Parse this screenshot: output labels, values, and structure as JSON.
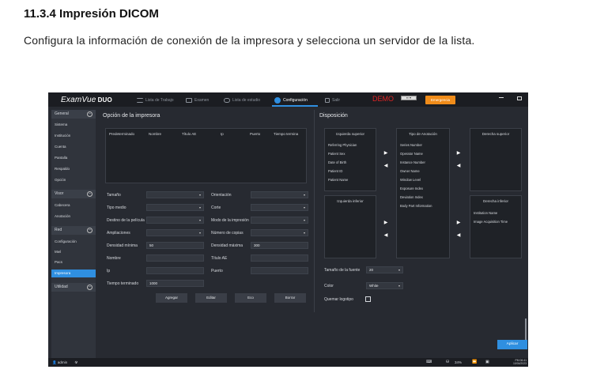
{
  "doc": {
    "heading": "11.3.4 Impresión DICOM",
    "paragraph": "Configura la información de conexión de la impresora y selecciona un servidor de la lista."
  },
  "app": {
    "logo": "ExamVue",
    "logo_suffix": "DUO",
    "nav_tabs": [
      {
        "label": "Lista de Trabajo"
      },
      {
        "label": "Examen"
      },
      {
        "label": "Lista de estudio"
      },
      {
        "label": "Configuración"
      },
      {
        "label": "Salir"
      }
    ],
    "demo_text": "DEMO",
    "emergency_label": "Emergencia",
    "accent_color": "#2f8fe0",
    "emergency_color": "#f08c1a"
  },
  "sidebar": {
    "groups": [
      {
        "label": "General",
        "items": [
          "Sistema",
          "Institución",
          "Cuenta",
          "Pantalla",
          "Respaldo",
          "Opción"
        ]
      },
      {
        "label": "Visor",
        "items": [
          "Cabecera",
          "Anotación"
        ]
      },
      {
        "label": "Red",
        "items": [
          "Configuración",
          "Mwl",
          "Pacs",
          "Impresora"
        ]
      },
      {
        "label": "Utilidad",
        "items": []
      }
    ],
    "selected": "Impresora"
  },
  "printer": {
    "title": "Opción de la impresora",
    "columns": [
      "Predeterminado",
      "Nombre",
      "Título AE",
      "Ip",
      "Puerto",
      "Tiempo termina"
    ],
    "fields_left": [
      {
        "label": "Tamaño",
        "value": ""
      },
      {
        "label": "Tipo medio",
        "value": ""
      },
      {
        "label": "Destino de la película",
        "value": ""
      },
      {
        "label": "Ampliaciones",
        "value": ""
      },
      {
        "label": "Densidad mínima",
        "value": "50"
      },
      {
        "label": "Nombre",
        "value": ""
      },
      {
        "label": "Ip",
        "value": ""
      },
      {
        "label": "Tiempo terminado",
        "value": "1000"
      }
    ],
    "fields_right": [
      {
        "label": "Orientación",
        "value": ""
      },
      {
        "label": "Corte",
        "value": ""
      },
      {
        "label": "Modo de la impresión",
        "value": ""
      },
      {
        "label": "Número de copias",
        "value": ""
      },
      {
        "label": "Densidad máxima",
        "value": "300"
      },
      {
        "label": "Título AE",
        "value": ""
      },
      {
        "label": "Puerto",
        "value": ""
      }
    ],
    "buttons": [
      "Agregar",
      "Editar",
      "Eco",
      "Borrar"
    ]
  },
  "layout_panel": {
    "title": "Disposición",
    "top_left": {
      "title": "Izquierda superior",
      "items": [
        "Referring Physician",
        "Patient Sex",
        "Date of Birth",
        "Patient ID",
        "Patient Name"
      ]
    },
    "annotation": {
      "title": "Tipo de Anotación",
      "items": [
        "Series Number",
        "Operator Name",
        "Instance Number",
        "Owner Name",
        "Window Level",
        "Exposure Index",
        "Deviation Index",
        "Body Part Information"
      ]
    },
    "top_right": {
      "title": "Derecha superior",
      "items": []
    },
    "bottom_left": {
      "title": "Izquierda inferior",
      "items": []
    },
    "bottom_right": {
      "title": "Derecha inferior",
      "items": [
        "Institution Name",
        "Image Acquisition Time"
      ]
    },
    "font_size_label": "Tamaño de la fuente",
    "font_size_value": "20",
    "color_label": "Color",
    "color_value": "White",
    "burn_logo_label": "Quemar logotipo",
    "apply_label": "Aplicar"
  },
  "status": {
    "user": "admin",
    "battery": "34%",
    "time": "PM 06:41",
    "date": "10/04/2023"
  }
}
